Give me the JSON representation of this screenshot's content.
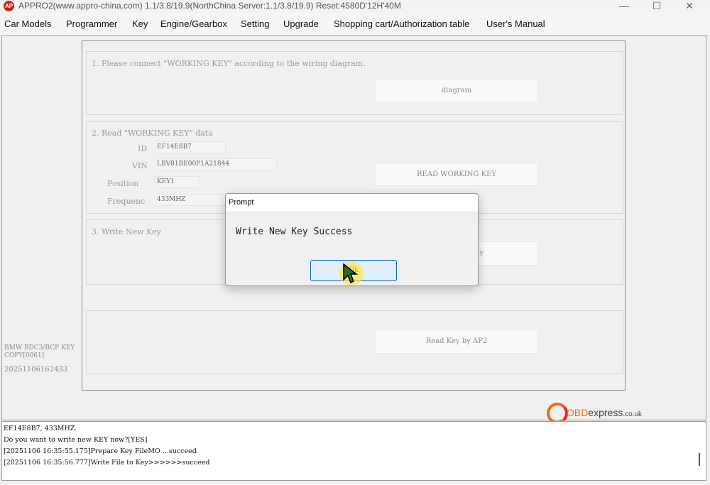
{
  "window": {
    "title": "APPRO2(www.appro-china.com)  1.1/3.8/19.9(NorthChina Server:1.1/3.8/19.9)  Reset:4580D'12H'40M",
    "icon_label": "AP",
    "minimize": "—",
    "maximize": "☐",
    "close": "✕"
  },
  "menu": [
    "Car Models",
    "Programmer",
    "Key",
    "Engine/Gearbox",
    "Setting",
    "Upgrade",
    "Shopping cart/Authorization table",
    "User's Manual"
  ],
  "step1": {
    "text": "1. Please connect \"WORKING KEY\" according to the wiring diagram.",
    "button": "diagram"
  },
  "step2": {
    "text": "2. Read \"WORKING KEY\" data",
    "fields": [
      {
        "label": "ID",
        "value": "EF14E8B7"
      },
      {
        "label": "VIN",
        "value": "LBV81BE00P1A21844"
      },
      {
        "label": "Position",
        "value": "KEY1"
      },
      {
        "label": "Frequenc",
        "value": "433MHZ"
      }
    ],
    "button": "READ WORKING KEY"
  },
  "step3": {
    "text": "3. Write New Key",
    "button_partial": "y"
  },
  "step4": {
    "button": "Read Key by AP2"
  },
  "sidebar": {
    "line1": "BMW BDC3/BCP KEY",
    "line2": "COPY[0061]",
    "line3": "20251106162433"
  },
  "dialog": {
    "title": "Prompt",
    "message": "Write New Key Success",
    "ok": "Ok"
  },
  "log": [
    "EF14E8B7, 433MHZ.",
    "Do you want to write new KEY now?[YES]",
    "[20251106 16:35:55.175]Prepare Key FileMO ...succeed",
    "[20251106 16:35:56.777]Write File to Key>>>>>>succeed"
  ],
  "watermark": {
    "brand": "OBD",
    "domain": "express",
    "tld": ".co.uk"
  }
}
